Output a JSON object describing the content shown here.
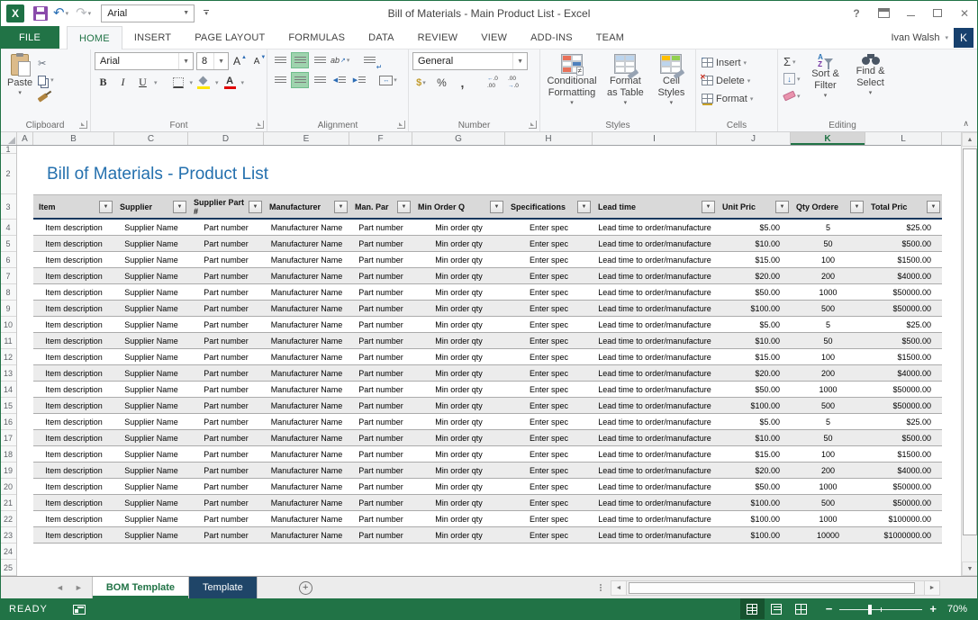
{
  "window": {
    "title": "Bill of Materials - Main Product List - Excel",
    "qat_font_value": "Arial",
    "help_label": "?"
  },
  "ribbon": {
    "tabs": [
      {
        "label": "FILE",
        "active": false
      },
      {
        "label": "HOME",
        "active": true
      },
      {
        "label": "INSERT",
        "active": false
      },
      {
        "label": "PAGE LAYOUT",
        "active": false
      },
      {
        "label": "FORMULAS",
        "active": false
      },
      {
        "label": "DATA",
        "active": false
      },
      {
        "label": "REVIEW",
        "active": false
      },
      {
        "label": "VIEW",
        "active": false
      },
      {
        "label": "ADD-INS",
        "active": false
      },
      {
        "label": "TEAM",
        "active": false
      }
    ],
    "user_name": "Ivan Walsh",
    "avatar_initial": "K",
    "groups": {
      "clipboard": {
        "label": "Clipboard",
        "paste_label": "Paste"
      },
      "font": {
        "label": "Font",
        "family": "Arial",
        "size": "8",
        "bold": "B",
        "italic": "I",
        "underline": "U"
      },
      "alignment": {
        "label": "Alignment"
      },
      "number": {
        "label": "Number",
        "format_value": "General",
        "percent": "%",
        "comma": ","
      },
      "styles": {
        "label": "Styles",
        "conditional_formatting": "Conditional Formatting",
        "format_as_table": "Format as Table",
        "cell_styles": "Cell Styles"
      },
      "cells": {
        "label": "Cells",
        "insert": "Insert",
        "delete": "Delete",
        "format": "Format"
      },
      "editing": {
        "label": "Editing",
        "autosum": "Σ",
        "sort_filter": "Sort & Filter",
        "find_select": "Find & Select"
      }
    }
  },
  "grid": {
    "column_letters": [
      "A",
      "B",
      "C",
      "D",
      "E",
      "F",
      "G",
      "H",
      "I",
      "J",
      "K",
      "L"
    ],
    "selected_column": "K",
    "row_count": 25,
    "sheet_title": "Bill of Materials - Product List",
    "table": {
      "headers": [
        "Item",
        "Supplier",
        "Supplier Part #",
        "Manufacturer",
        "Man. Par",
        "Min Order Q",
        "Specifications",
        "Lead time",
        "Unit Pric",
        "Qty Ordere",
        "Total Pric"
      ],
      "rows": [
        [
          "Item description",
          "Supplier Name",
          "Part number",
          "Manufacturer Name",
          "Part number",
          "Min order qty",
          "Enter spec",
          "Lead time to order/manufacture",
          "$5.00",
          "5",
          "$25.00"
        ],
        [
          "Item description",
          "Supplier Name",
          "Part number",
          "Manufacturer Name",
          "Part number",
          "Min order qty",
          "Enter spec",
          "Lead time to order/manufacture",
          "$10.00",
          "50",
          "$500.00"
        ],
        [
          "Item description",
          "Supplier Name",
          "Part number",
          "Manufacturer Name",
          "Part number",
          "Min order qty",
          "Enter spec",
          "Lead time to order/manufacture",
          "$15.00",
          "100",
          "$1500.00"
        ],
        [
          "Item description",
          "Supplier Name",
          "Part number",
          "Manufacturer Name",
          "Part number",
          "Min order qty",
          "Enter spec",
          "Lead time to order/manufacture",
          "$20.00",
          "200",
          "$4000.00"
        ],
        [
          "Item description",
          "Supplier Name",
          "Part number",
          "Manufacturer Name",
          "Part number",
          "Min order qty",
          "Enter spec",
          "Lead time to order/manufacture",
          "$50.00",
          "1000",
          "$50000.00"
        ],
        [
          "Item description",
          "Supplier Name",
          "Part number",
          "Manufacturer Name",
          "Part number",
          "Min order qty",
          "Enter spec",
          "Lead time to order/manufacture",
          "$100.00",
          "500",
          "$50000.00"
        ],
        [
          "Item description",
          "Supplier Name",
          "Part number",
          "Manufacturer Name",
          "Part number",
          "Min order qty",
          "Enter spec",
          "Lead time to order/manufacture",
          "$5.00",
          "5",
          "$25.00"
        ],
        [
          "Item description",
          "Supplier Name",
          "Part number",
          "Manufacturer Name",
          "Part number",
          "Min order qty",
          "Enter spec",
          "Lead time to order/manufacture",
          "$10.00",
          "50",
          "$500.00"
        ],
        [
          "Item description",
          "Supplier Name",
          "Part number",
          "Manufacturer Name",
          "Part number",
          "Min order qty",
          "Enter spec",
          "Lead time to order/manufacture",
          "$15.00",
          "100",
          "$1500.00"
        ],
        [
          "Item description",
          "Supplier Name",
          "Part number",
          "Manufacturer Name",
          "Part number",
          "Min order qty",
          "Enter spec",
          "Lead time to order/manufacture",
          "$20.00",
          "200",
          "$4000.00"
        ],
        [
          "Item description",
          "Supplier Name",
          "Part number",
          "Manufacturer Name",
          "Part number",
          "Min order qty",
          "Enter spec",
          "Lead time to order/manufacture",
          "$50.00",
          "1000",
          "$50000.00"
        ],
        [
          "Item description",
          "Supplier Name",
          "Part number",
          "Manufacturer Name",
          "Part number",
          "Min order qty",
          "Enter spec",
          "Lead time to order/manufacture",
          "$100.00",
          "500",
          "$50000.00"
        ],
        [
          "Item description",
          "Supplier Name",
          "Part number",
          "Manufacturer Name",
          "Part number",
          "Min order qty",
          "Enter spec",
          "Lead time to order/manufacture",
          "$5.00",
          "5",
          "$25.00"
        ],
        [
          "Item description",
          "Supplier Name",
          "Part number",
          "Manufacturer Name",
          "Part number",
          "Min order qty",
          "Enter spec",
          "Lead time to order/manufacture",
          "$10.00",
          "50",
          "$500.00"
        ],
        [
          "Item description",
          "Supplier Name",
          "Part number",
          "Manufacturer Name",
          "Part number",
          "Min order qty",
          "Enter spec",
          "Lead time to order/manufacture",
          "$15.00",
          "100",
          "$1500.00"
        ],
        [
          "Item description",
          "Supplier Name",
          "Part number",
          "Manufacturer Name",
          "Part number",
          "Min order qty",
          "Enter spec",
          "Lead time to order/manufacture",
          "$20.00",
          "200",
          "$4000.00"
        ],
        [
          "Item description",
          "Supplier Name",
          "Part number",
          "Manufacturer Name",
          "Part number",
          "Min order qty",
          "Enter spec",
          "Lead time to order/manufacture",
          "$50.00",
          "1000",
          "$50000.00"
        ],
        [
          "Item description",
          "Supplier Name",
          "Part number",
          "Manufacturer Name",
          "Part number",
          "Min order qty",
          "Enter spec",
          "Lead time to order/manufacture",
          "$100.00",
          "500",
          "$50000.00"
        ],
        [
          "Item description",
          "Supplier Name",
          "Part number",
          "Manufacturer Name",
          "Part number",
          "Min order qty",
          "Enter spec",
          "Lead time to order/manufacture",
          "$100.00",
          "1000",
          "$100000.00"
        ],
        [
          "Item description",
          "Supplier Name",
          "Part number",
          "Manufacturer Name",
          "Part number",
          "Min order qty",
          "Enter spec",
          "Lead time to order/manufacture",
          "$100.00",
          "10000",
          "$1000000.00"
        ]
      ]
    }
  },
  "sheet_tabs": {
    "tabs": [
      {
        "label": "BOM Template",
        "active": true
      },
      {
        "label": "Template",
        "active": false
      }
    ],
    "add_label": "+"
  },
  "status_bar": {
    "mode": "READY",
    "zoom_level": "70%"
  }
}
